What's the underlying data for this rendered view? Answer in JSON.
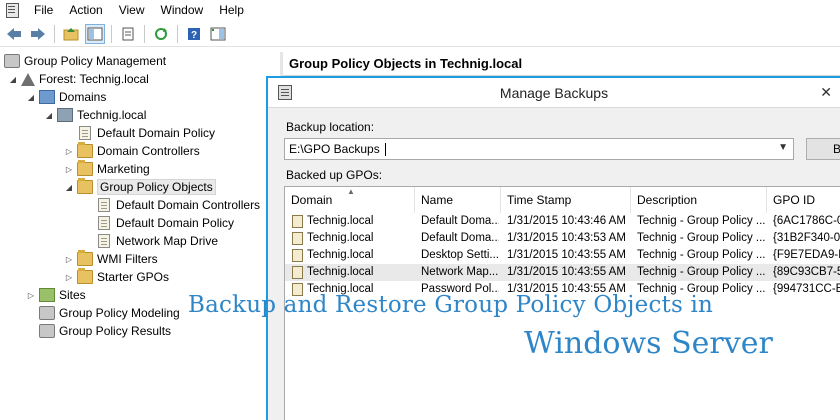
{
  "menubar": {
    "items": [
      "File",
      "Action",
      "View",
      "Window",
      "Help"
    ]
  },
  "toolbar": {
    "icons": [
      "back-arrow-icon",
      "forward-arrow-icon",
      "up-folder-icon",
      "show-hide-tree-icon",
      "properties-icon",
      "refresh-icon",
      "help-icon",
      "show-action-pane-icon"
    ]
  },
  "tree": {
    "root": "Group Policy Management",
    "forest": "Forest: Technig.local",
    "domains": "Domains",
    "domain": "Technig.local",
    "default_domain_policy": "Default Domain Policy",
    "domain_controllers": "Domain Controllers",
    "marketing": "Marketing",
    "gpo_container": "Group Policy Objects",
    "gpo_items": [
      "Default Domain Controllers",
      "Default Domain Policy",
      "Network Map Drive"
    ],
    "wmi_filters": "WMI Filters",
    "starter_gpos": "Starter GPOs",
    "sites": "Sites",
    "modeling": "Group Policy Modeling",
    "results": "Group Policy Results"
  },
  "right_pane": {
    "title": "Group Policy Objects in Technig.local"
  },
  "dialog": {
    "title": "Manage Backups",
    "close_glyph": "✕",
    "backup_location_label": "Backup location:",
    "backup_location_value": "E:\\GPO Backups",
    "browse_label": "Browse...",
    "backed_up_label": "Backed up GPOs:",
    "columns": [
      "Domain",
      "Name",
      "Time Stamp",
      "Description",
      "GPO ID"
    ],
    "rows": [
      {
        "domain": "Technig.local",
        "name": "Default Doma...",
        "time": "1/31/2015 10:43:46 AM",
        "description": "Technig - Group Policy ...",
        "gpo_id": "{6AC1786C-0"
      },
      {
        "domain": "Technig.local",
        "name": "Default Doma...",
        "time": "1/31/2015 10:43:53 AM",
        "description": "Technig - Group Policy ...",
        "gpo_id": "{31B2F340-0"
      },
      {
        "domain": "Technig.local",
        "name": "Desktop Setti...",
        "time": "1/31/2015 10:43:55 AM",
        "description": "Technig - Group Policy ...",
        "gpo_id": "{F9E7EDA9-E"
      },
      {
        "domain": "Technig.local",
        "name": "Network Map...",
        "time": "1/31/2015 10:43:55 AM",
        "description": "Technig - Group Policy ...",
        "gpo_id": "{89C93CB7-5"
      },
      {
        "domain": "Technig.local",
        "name": "Password Pol...",
        "time": "1/31/2015 10:43:55 AM",
        "description": "Technig - Group Policy ...",
        "gpo_id": "{994731CC-B"
      }
    ]
  },
  "watermark": {
    "line1": "Backup and Restore Group Policy Objects in",
    "line2": "Windows Server"
  },
  "colors": {
    "accent": "#1a9de1",
    "watermark": "#2e86c8"
  }
}
